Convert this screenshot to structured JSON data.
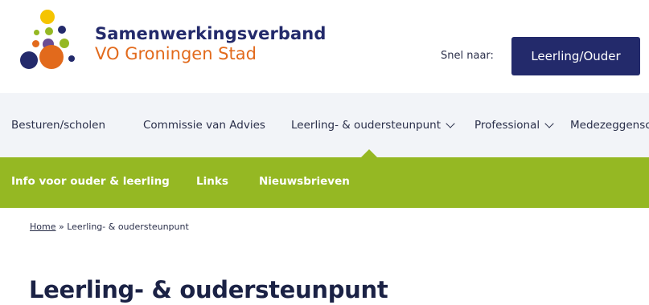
{
  "brand": {
    "line1": "Samenwerkingsverband",
    "line2": "VO Groningen Stad"
  },
  "quick_nav": {
    "label": "Snel naar:",
    "button": "Leerling/Ouder"
  },
  "main_nav": {
    "items": [
      {
        "label": "Besturen/scholen"
      },
      {
        "label": "Commissie van Advies"
      },
      {
        "label": "Leerling- & oudersteunpunt"
      },
      {
        "label": "Professional"
      },
      {
        "label": "Medezeggensc"
      }
    ]
  },
  "sub_nav": {
    "items": [
      {
        "label": "Info voor ouder & leerling"
      },
      {
        "label": "Links"
      },
      {
        "label": "Nieuwsbrieven"
      }
    ]
  },
  "breadcrumb": {
    "home": "Home",
    "separator": " » ",
    "current": "Leerling- & oudersteunpunt"
  },
  "page": {
    "title": "Leerling- & oudersteunpunt"
  },
  "colors": {
    "navy": "#232a6b",
    "orange": "#e26a1c",
    "green": "#95b823",
    "nav_bg": "#f2f4f8"
  }
}
